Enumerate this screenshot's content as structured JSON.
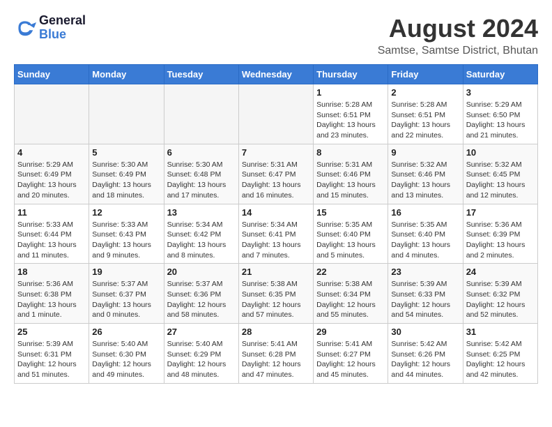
{
  "header": {
    "logo_line1": "General",
    "logo_line2": "Blue",
    "month_title": "August 2024",
    "subtitle": "Samtse, Samtse District, Bhutan"
  },
  "weekdays": [
    "Sunday",
    "Monday",
    "Tuesday",
    "Wednesday",
    "Thursday",
    "Friday",
    "Saturday"
  ],
  "weeks": [
    [
      {
        "day": "",
        "info": ""
      },
      {
        "day": "",
        "info": ""
      },
      {
        "day": "",
        "info": ""
      },
      {
        "day": "",
        "info": ""
      },
      {
        "day": "1",
        "info": "Sunrise: 5:28 AM\nSunset: 6:51 PM\nDaylight: 13 hours\nand 23 minutes."
      },
      {
        "day": "2",
        "info": "Sunrise: 5:28 AM\nSunset: 6:51 PM\nDaylight: 13 hours\nand 22 minutes."
      },
      {
        "day": "3",
        "info": "Sunrise: 5:29 AM\nSunset: 6:50 PM\nDaylight: 13 hours\nand 21 minutes."
      }
    ],
    [
      {
        "day": "4",
        "info": "Sunrise: 5:29 AM\nSunset: 6:49 PM\nDaylight: 13 hours\nand 20 minutes."
      },
      {
        "day": "5",
        "info": "Sunrise: 5:30 AM\nSunset: 6:49 PM\nDaylight: 13 hours\nand 18 minutes."
      },
      {
        "day": "6",
        "info": "Sunrise: 5:30 AM\nSunset: 6:48 PM\nDaylight: 13 hours\nand 17 minutes."
      },
      {
        "day": "7",
        "info": "Sunrise: 5:31 AM\nSunset: 6:47 PM\nDaylight: 13 hours\nand 16 minutes."
      },
      {
        "day": "8",
        "info": "Sunrise: 5:31 AM\nSunset: 6:46 PM\nDaylight: 13 hours\nand 15 minutes."
      },
      {
        "day": "9",
        "info": "Sunrise: 5:32 AM\nSunset: 6:46 PM\nDaylight: 13 hours\nand 13 minutes."
      },
      {
        "day": "10",
        "info": "Sunrise: 5:32 AM\nSunset: 6:45 PM\nDaylight: 13 hours\nand 12 minutes."
      }
    ],
    [
      {
        "day": "11",
        "info": "Sunrise: 5:33 AM\nSunset: 6:44 PM\nDaylight: 13 hours\nand 11 minutes."
      },
      {
        "day": "12",
        "info": "Sunrise: 5:33 AM\nSunset: 6:43 PM\nDaylight: 13 hours\nand 9 minutes."
      },
      {
        "day": "13",
        "info": "Sunrise: 5:34 AM\nSunset: 6:42 PM\nDaylight: 13 hours\nand 8 minutes."
      },
      {
        "day": "14",
        "info": "Sunrise: 5:34 AM\nSunset: 6:41 PM\nDaylight: 13 hours\nand 7 minutes."
      },
      {
        "day": "15",
        "info": "Sunrise: 5:35 AM\nSunset: 6:40 PM\nDaylight: 13 hours\nand 5 minutes."
      },
      {
        "day": "16",
        "info": "Sunrise: 5:35 AM\nSunset: 6:40 PM\nDaylight: 13 hours\nand 4 minutes."
      },
      {
        "day": "17",
        "info": "Sunrise: 5:36 AM\nSunset: 6:39 PM\nDaylight: 13 hours\nand 2 minutes."
      }
    ],
    [
      {
        "day": "18",
        "info": "Sunrise: 5:36 AM\nSunset: 6:38 PM\nDaylight: 13 hours\nand 1 minute."
      },
      {
        "day": "19",
        "info": "Sunrise: 5:37 AM\nSunset: 6:37 PM\nDaylight: 13 hours\nand 0 minutes."
      },
      {
        "day": "20",
        "info": "Sunrise: 5:37 AM\nSunset: 6:36 PM\nDaylight: 12 hours\nand 58 minutes."
      },
      {
        "day": "21",
        "info": "Sunrise: 5:38 AM\nSunset: 6:35 PM\nDaylight: 12 hours\nand 57 minutes."
      },
      {
        "day": "22",
        "info": "Sunrise: 5:38 AM\nSunset: 6:34 PM\nDaylight: 12 hours\nand 55 minutes."
      },
      {
        "day": "23",
        "info": "Sunrise: 5:39 AM\nSunset: 6:33 PM\nDaylight: 12 hours\nand 54 minutes."
      },
      {
        "day": "24",
        "info": "Sunrise: 5:39 AM\nSunset: 6:32 PM\nDaylight: 12 hours\nand 52 minutes."
      }
    ],
    [
      {
        "day": "25",
        "info": "Sunrise: 5:39 AM\nSunset: 6:31 PM\nDaylight: 12 hours\nand 51 minutes."
      },
      {
        "day": "26",
        "info": "Sunrise: 5:40 AM\nSunset: 6:30 PM\nDaylight: 12 hours\nand 49 minutes."
      },
      {
        "day": "27",
        "info": "Sunrise: 5:40 AM\nSunset: 6:29 PM\nDaylight: 12 hours\nand 48 minutes."
      },
      {
        "day": "28",
        "info": "Sunrise: 5:41 AM\nSunset: 6:28 PM\nDaylight: 12 hours\nand 47 minutes."
      },
      {
        "day": "29",
        "info": "Sunrise: 5:41 AM\nSunset: 6:27 PM\nDaylight: 12 hours\nand 45 minutes."
      },
      {
        "day": "30",
        "info": "Sunrise: 5:42 AM\nSunset: 6:26 PM\nDaylight: 12 hours\nand 44 minutes."
      },
      {
        "day": "31",
        "info": "Sunrise: 5:42 AM\nSunset: 6:25 PM\nDaylight: 12 hours\nand 42 minutes."
      }
    ]
  ]
}
